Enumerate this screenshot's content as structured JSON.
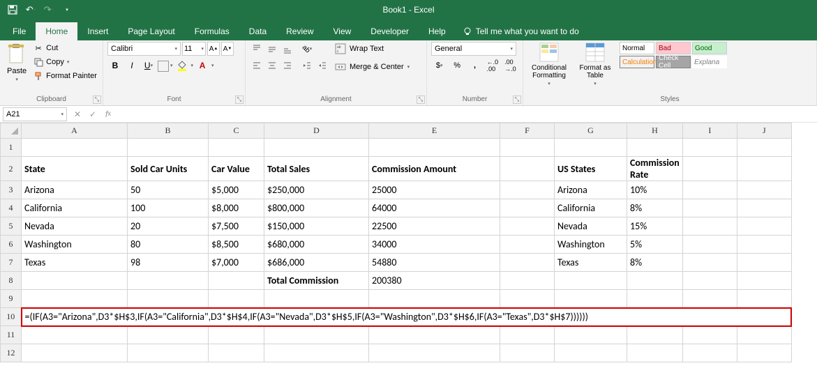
{
  "titlebar": {
    "doc": "Book1 - Excel"
  },
  "tabs": {
    "file": "File",
    "home": "Home",
    "insert": "Insert",
    "pagelayout": "Page Layout",
    "formulas": "Formulas",
    "data": "Data",
    "review": "Review",
    "view": "View",
    "developer": "Developer",
    "help": "Help",
    "tellme": "Tell me what you want to do"
  },
  "clipboard": {
    "paste": "Paste",
    "cut": "Cut",
    "copy": "Copy",
    "fmtpainter": "Format Painter",
    "label": "Clipboard"
  },
  "font": {
    "name": "Calibri",
    "size": "11",
    "label": "Font"
  },
  "alignment": {
    "wrap": "Wrap Text",
    "merge": "Merge & Center",
    "label": "Alignment"
  },
  "number": {
    "format": "General",
    "label": "Number"
  },
  "styles": {
    "cond": "Conditional Formatting",
    "fmttable": "Format as Table",
    "normal": "Normal",
    "bad": "Bad",
    "good": "Good",
    "calc": "Calculation",
    "check": "Check Cell",
    "explana": "Explana",
    "label": "Styles"
  },
  "namebox": "A21",
  "cols": [
    "A",
    "B",
    "C",
    "D",
    "E",
    "F",
    "G",
    "H",
    "I",
    "J"
  ],
  "rows": [
    "1",
    "2",
    "3",
    "4",
    "5",
    "6",
    "7",
    "8",
    "9",
    "10",
    "11",
    "12"
  ],
  "sheet": {
    "r2": {
      "A": "State",
      "B": "Sold Car Units",
      "C": "Car Value",
      "D": "Total Sales",
      "E": "Commission Amount",
      "G": "US States",
      "H": "Commission Rate"
    },
    "r3": {
      "A": "Arizona",
      "B": "50",
      "C": "$5,000",
      "D": "$250,000",
      "E": "25000",
      "G": "Arizona",
      "H": "10%"
    },
    "r4": {
      "A": "California",
      "B": "100",
      "C": "$8,000",
      "D": "$800,000",
      "E": "64000",
      "G": "California",
      "H": "8%"
    },
    "r5": {
      "A": "Nevada",
      "B": "20",
      "C": "$7,500",
      "D": "$150,000",
      "E": "22500",
      "G": "Nevada",
      "H": "15%"
    },
    "r6": {
      "A": "Washington",
      "B": "80",
      "C": "$8,500",
      "D": "$680,000",
      "E": "34000",
      "G": "Washington",
      "H": "5%"
    },
    "r7": {
      "A": "Texas",
      "B": "98",
      "C": "$7,000",
      "D": "$686,000",
      "E": "54880",
      "G": "Texas",
      "H": "8%"
    },
    "r8": {
      "D": "Total Commission",
      "E": "200380"
    },
    "r10": {
      "formula": "=(IF(A3=\"Arizona\",D3*$H$3,IF(A3=\"California\",D3*$H$4,IF(A3=\"Nevada\",D3*$H$5,IF(A3=\"Washington\",D3*$H$6,IF(A3=\"Texas\",D3*$H$7))))))"
    }
  }
}
